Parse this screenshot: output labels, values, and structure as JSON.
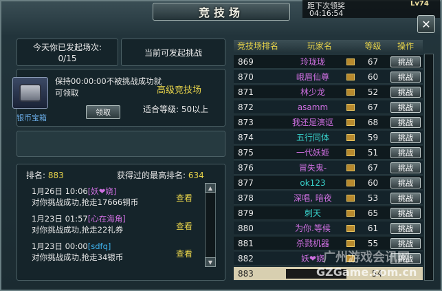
{
  "hud": {
    "next_reward_label": "距下次领奖",
    "countdown": "04:16:54",
    "level": "Lv74"
  },
  "window": {
    "title": "竞技场",
    "close": "✕"
  },
  "left": {
    "times_label": "今天你已发起场次:",
    "times_value": "0/15",
    "current_label": "当前可发起挑战",
    "chest": {
      "icon": "chest-icon",
      "label": "银币宝箱",
      "desc": "保持00:00:00不被挑战成功就可领取",
      "claim": "领取"
    },
    "advanced_arena": "高级竞技场",
    "level_req": "适合等级: 50以上",
    "rank_label": "排名:",
    "rank_value": "883",
    "best_label": "获得过的最高排名:",
    "best_value": "634",
    "logs": [
      {
        "time": "1月26日  10:06",
        "name": "[妖❤娆]",
        "text": "对你挑战成功,抢走17666铜币",
        "view": "查看",
        "color": "purple"
      },
      {
        "time": "1月23日  01:57",
        "name": "[心在海角]",
        "text": "对你挑战成功,抢走22礼券",
        "view": "查看",
        "color": "purple"
      },
      {
        "time": "1月23日  00:00",
        "name": "[sdfq]",
        "text": "对你挑战成功,抢走34银币",
        "view": "查看",
        "color": "cyan"
      }
    ]
  },
  "table": {
    "headers": [
      "竞技场排名",
      "玩家名",
      "等级",
      "操作"
    ],
    "rows": [
      {
        "rank": "869",
        "name": "玲珑珑",
        "level": "67",
        "action": "挑战",
        "color": "purple"
      },
      {
        "rank": "870",
        "name": "峨眉仙尊",
        "level": "60",
        "action": "挑战",
        "color": "purple"
      },
      {
        "rank": "871",
        "name": "林少龙",
        "level": "52",
        "action": "挑战",
        "color": "purple"
      },
      {
        "rank": "872",
        "name": "asamm",
        "level": "67",
        "action": "挑战",
        "color": "purple"
      },
      {
        "rank": "873",
        "name": "我还是演讴",
        "level": "68",
        "action": "挑战",
        "color": "purple"
      },
      {
        "rank": "874",
        "name": "五行同体",
        "level": "59",
        "action": "挑战",
        "color": "cyan"
      },
      {
        "rank": "875",
        "name": "一代妖姬",
        "level": "51",
        "action": "挑战",
        "color": "purple"
      },
      {
        "rank": "876",
        "name": "冒失鬼-",
        "level": "67",
        "action": "挑战",
        "color": "purple"
      },
      {
        "rank": "877",
        "name": "ok123",
        "level": "60",
        "action": "挑战",
        "color": "cyan"
      },
      {
        "rank": "878",
        "name": "深唱, 暗夜",
        "level": "53",
        "action": "挑战",
        "color": "purple"
      },
      {
        "rank": "879",
        "name": "刺天",
        "level": "65",
        "action": "挑战",
        "color": "cyan"
      },
      {
        "rank": "880",
        "name": "为你.等候",
        "level": "61",
        "action": "挑战",
        "color": "purple"
      },
      {
        "rank": "881",
        "name": "杀戮机器",
        "level": "55",
        "action": "挑战",
        "color": "purple"
      },
      {
        "rank": "882",
        "name": "妖❤娆",
        "level": "",
        "action": "挑战",
        "color": "purple"
      }
    ],
    "self": {
      "rank": "883",
      "level": "54"
    }
  },
  "watermark": {
    "line1": "广州游戏会讯网",
    "line2": "GZGame.com.cn"
  }
}
